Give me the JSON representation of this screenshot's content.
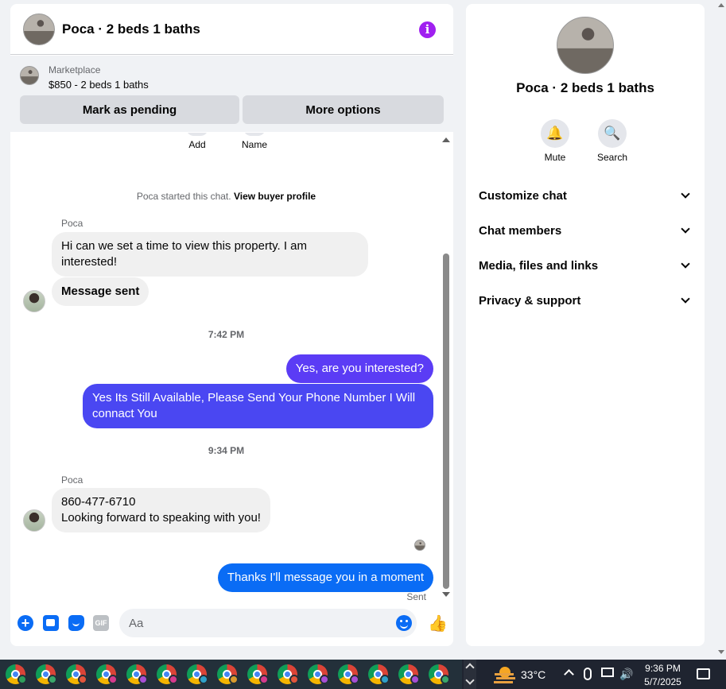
{
  "chat": {
    "title": "Poca · 2 beds 1 baths",
    "marketplace": {
      "label": "Marketplace",
      "listing": "$850 - 2 beds 1 baths",
      "mark_pending": "Mark as pending",
      "more_options": "More options"
    },
    "top_actions": [
      "Add",
      "Name"
    ],
    "started_text": "Poca started this chat.",
    "view_profile": "View buyer profile",
    "messages": [
      {
        "sender": "Poca",
        "text": "Hi can we set a time to view this property. I am interested!"
      },
      {
        "text": "Message sent"
      },
      {
        "timestamp": "7:42 PM"
      },
      {
        "text": "Yes, are you interested?"
      },
      {
        "text": "Yes Its Still Available, Please Send Your Phone Number I Will connact You"
      },
      {
        "timestamp": "9:34 PM"
      },
      {
        "sender": "Poca",
        "line1": "860-477-6710",
        "line2": "Looking forward to speaking with you!"
      },
      {
        "text": "Thanks I'll message you in a moment",
        "status": "Sent"
      }
    ],
    "composer": {
      "placeholder": "Aa",
      "gif_label": "GIF"
    }
  },
  "info": {
    "title": "Poca · 2 beds 1 baths",
    "actions": [
      "Mute",
      "Search"
    ],
    "sections": [
      "Customize chat",
      "Chat members",
      "Media, files and links",
      "Privacy & support"
    ]
  },
  "taskbar": {
    "temperature": "33°C",
    "time": "9:36 PM",
    "date": "5/7/2025",
    "badge_colors": [
      "#2e9f5b",
      "#3aa86b",
      "#e3553c",
      "#d63a8e",
      "#a84fd6",
      "#d63a8e",
      "#2fa1c9",
      "#d99a2e",
      "#d63a8e",
      "#e3553c",
      "#a84fd6",
      "#a84fd6",
      "#2fa1c9",
      "#a84fd6",
      "#3aa86b"
    ]
  },
  "colors": {
    "outgoing_1": "#5b3cf5",
    "outgoing_2": "#4a47f2",
    "outgoing_3": "#0a6cf5",
    "accent": "#0a6cf5",
    "info_icon": "#a020f0"
  }
}
